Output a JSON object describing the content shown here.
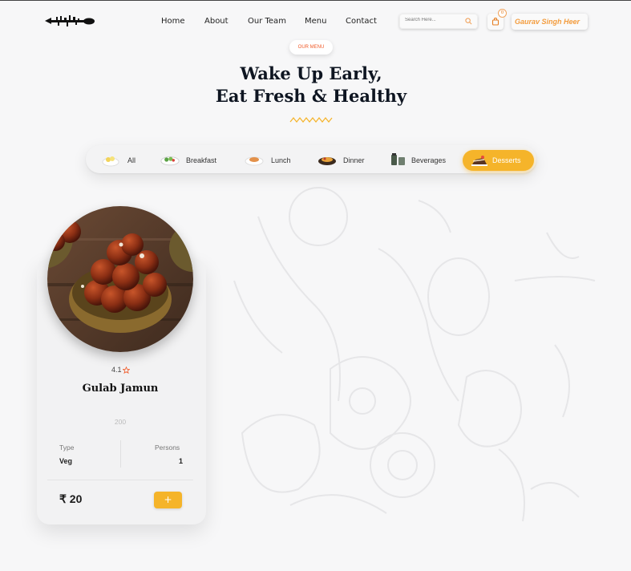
{
  "header": {
    "nav": [
      "Home",
      "About",
      "Our Team",
      "Menu",
      "Contact"
    ],
    "search_placeholder": "Search Here...",
    "cart_count": "0",
    "user_name": "Gaurav Singh Heer"
  },
  "hero": {
    "tag": "OUR MENU",
    "heading_line1": "Wake Up Early,",
    "heading_line2": "Eat Fresh & Healthy"
  },
  "filters": [
    {
      "label": "All",
      "icon": "rice-bowl-icon",
      "active": false
    },
    {
      "label": "Breakfast",
      "icon": "salad-icon",
      "active": false
    },
    {
      "label": "Lunch",
      "icon": "plate-icon",
      "active": false
    },
    {
      "label": "Dinner",
      "icon": "dinner-plate-icon",
      "active": false
    },
    {
      "label": "Beverages",
      "icon": "beverage-icon",
      "active": false
    },
    {
      "label": "Desserts",
      "icon": "cake-icon",
      "active": true
    }
  ],
  "card": {
    "rating": "4.1",
    "name": "Gulab Jamun",
    "calories": "200",
    "type_label": "Type",
    "type_value": "Veg",
    "persons_label": "Persons",
    "persons_value": "1",
    "price": "₹ 20",
    "add_label": "+"
  },
  "colors": {
    "accent": "#f5b42a",
    "user_orange": "#f39c3d",
    "tag_red": "#f05a28",
    "heading": "#0e1521"
  }
}
